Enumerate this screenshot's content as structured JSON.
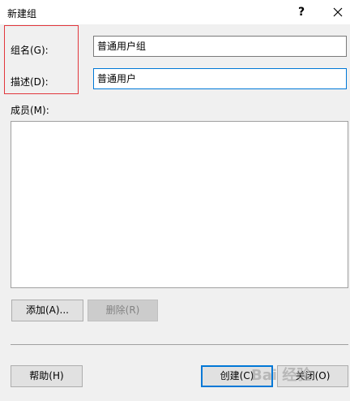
{
  "window": {
    "title": "新建组",
    "help_label": "?"
  },
  "group_name": {
    "label": "组名(G):",
    "value": "普通用户组"
  },
  "description": {
    "label": "描述(D):",
    "value": "普通用户"
  },
  "members": {
    "label": "成员(M):",
    "items": []
  },
  "buttons": {
    "add": "添加(A)...",
    "remove": "删除(R)",
    "help": "帮助(H)",
    "create": "创建(C)",
    "close": "关闭(O)"
  },
  "watermark": "Bai 经验",
  "colors": {
    "highlight_border": "#e2363c",
    "focus_border": "#0078d7"
  }
}
